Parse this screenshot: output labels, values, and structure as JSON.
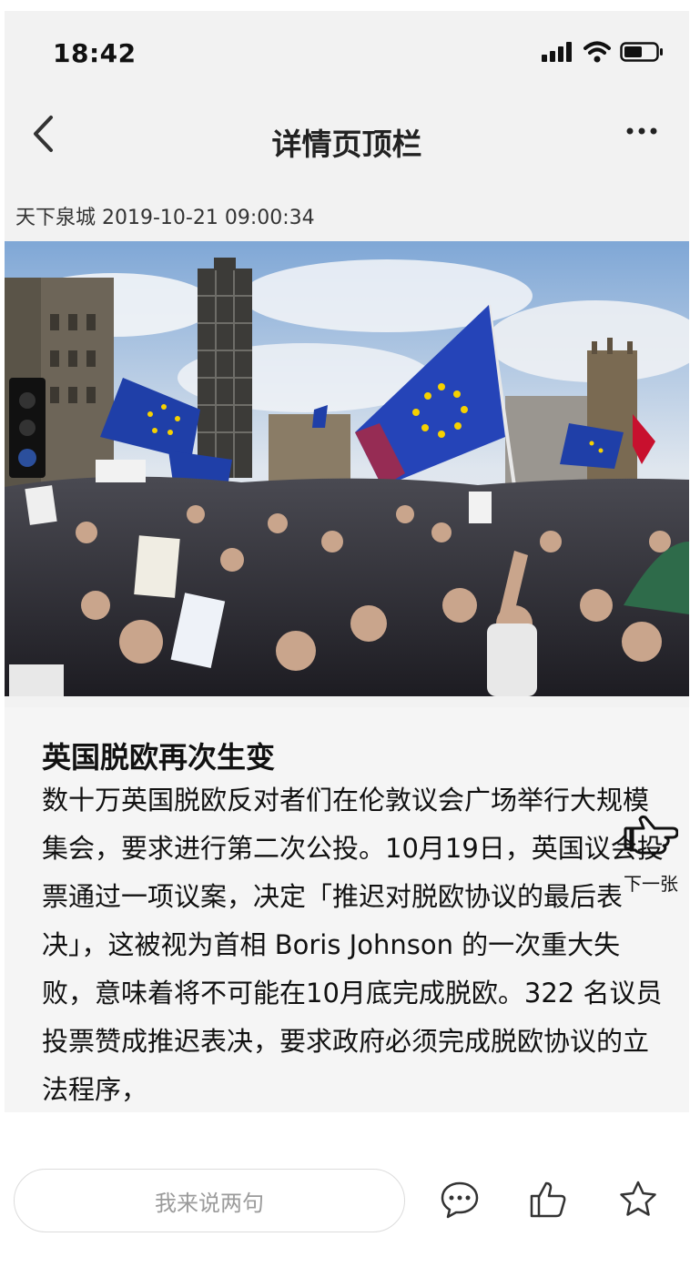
{
  "status_bar": {
    "time": "18:42",
    "icons": [
      "cellular-signal-icon",
      "wifi-icon",
      "battery-icon"
    ]
  },
  "nav": {
    "title": "详情页顶栏",
    "back_icon": "chevron-left-icon",
    "more_icon": "more-dots-icon"
  },
  "meta": {
    "source_time": "天下泉城 2019-10-21 09:00:34"
  },
  "image": {
    "description_icon": "news-photo"
  },
  "article": {
    "title": "英国脱欧再次生变",
    "body": "数十万英国脱欧反对者们在伦敦议会广场举行大规模集会，要求进行第二次公投。10月19日，英国议会投票通过一项议案，决定「推迟对脱欧协议的最后表决」，这被视为首相 Boris Johnson 的一次重大失败，意味着将不可能在10月底完成脱欧。322 名议员投票赞成推迟表决，要求政府必须完成脱欧协议的立法程序，"
  },
  "next_hint": {
    "label": "下一张",
    "icon": "pointing-hand-icon"
  },
  "bottom_bar": {
    "comment_placeholder": "我来说两句",
    "icons": [
      "comment-icon",
      "like-icon",
      "star-icon"
    ]
  },
  "colors": {
    "background": "#f2f2f2",
    "text": "#111111",
    "eu_blue": "#1f3fa8",
    "eu_gold": "#f6d100"
  }
}
